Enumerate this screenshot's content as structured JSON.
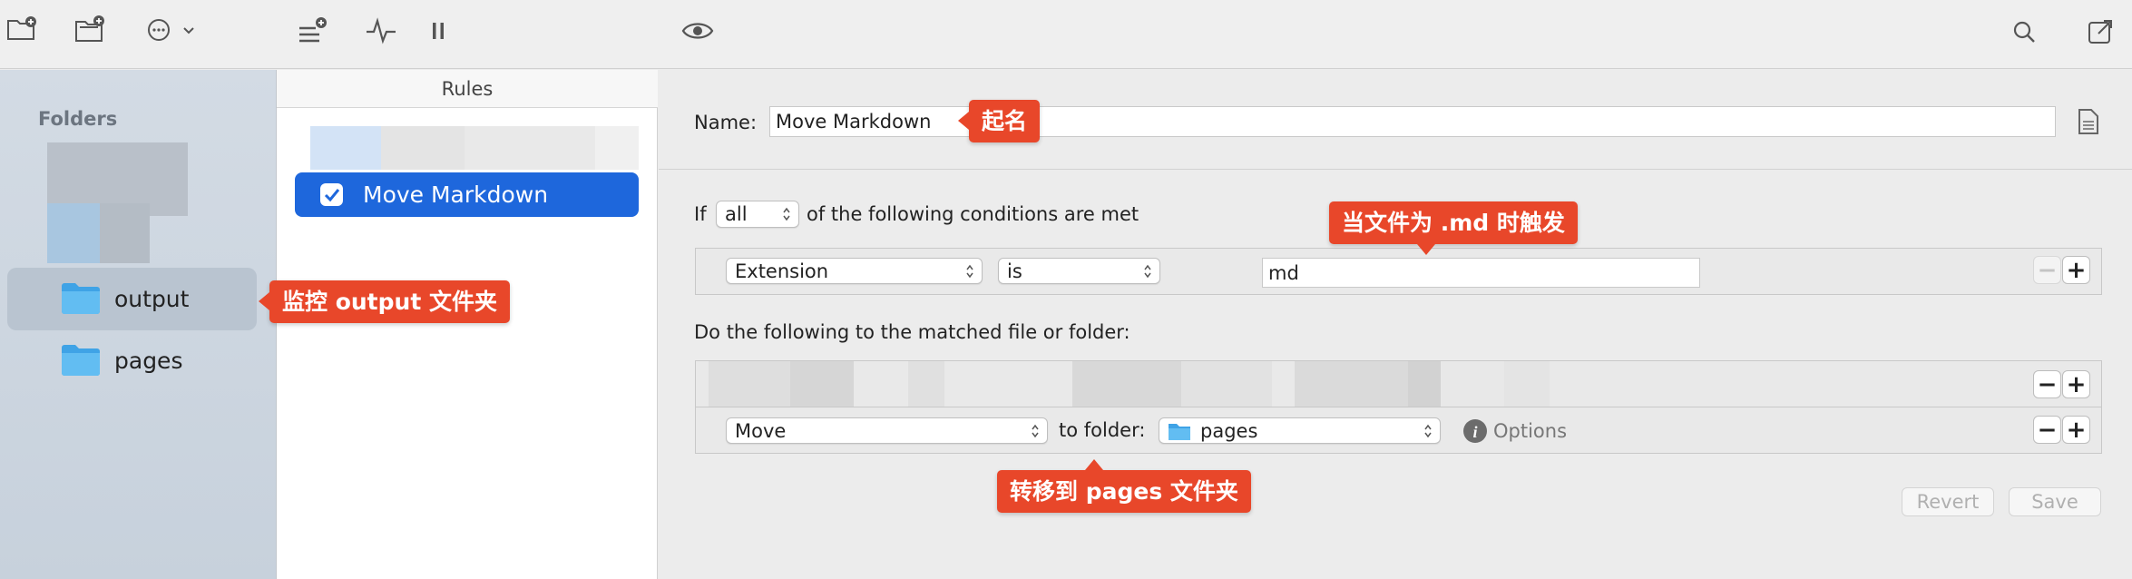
{
  "toolbar": {
    "icons": [
      "new-folder-icon",
      "add-folder-icon",
      "more-menu-icon",
      "chevron-down-icon",
      "add-rule-icon",
      "activity-icon",
      "pause-icon",
      "preview-eye-icon",
      "search-icon",
      "window-icon"
    ]
  },
  "sidebar": {
    "header": "Folders",
    "items": [
      {
        "label": "output",
        "selected": true,
        "icon": "folder-icon"
      },
      {
        "label": "pages",
        "selected": false,
        "icon": "folder-icon"
      }
    ]
  },
  "rules": {
    "header": "Rules",
    "items": [
      {
        "label": "Move Markdown",
        "checked": true,
        "selected": true
      }
    ]
  },
  "detail": {
    "name_label": "Name:",
    "name_value": "Move Markdown",
    "if_label": "If",
    "match_select": "all",
    "conditions_text": "of the following conditions are met",
    "condition": {
      "attribute": "Extension",
      "operator": "is",
      "value": "md"
    },
    "actions_title": "Do the following to the matched file or folder:",
    "action": {
      "verb": "Move",
      "to_folder_label": "to folder:",
      "folder": "pages",
      "options_label": "Options"
    },
    "revert_label": "Revert",
    "save_label": "Save",
    "minus": "−",
    "plus": "+"
  },
  "callouts": {
    "name": "起名",
    "folder": "监控 output 文件夹",
    "condition": "当文件为 .md 时触发",
    "action": "转移到 pages 文件夹"
  },
  "colors": {
    "accent": "#1e67dc",
    "callout": "#e8472a",
    "folder": "#5ab4ef"
  }
}
